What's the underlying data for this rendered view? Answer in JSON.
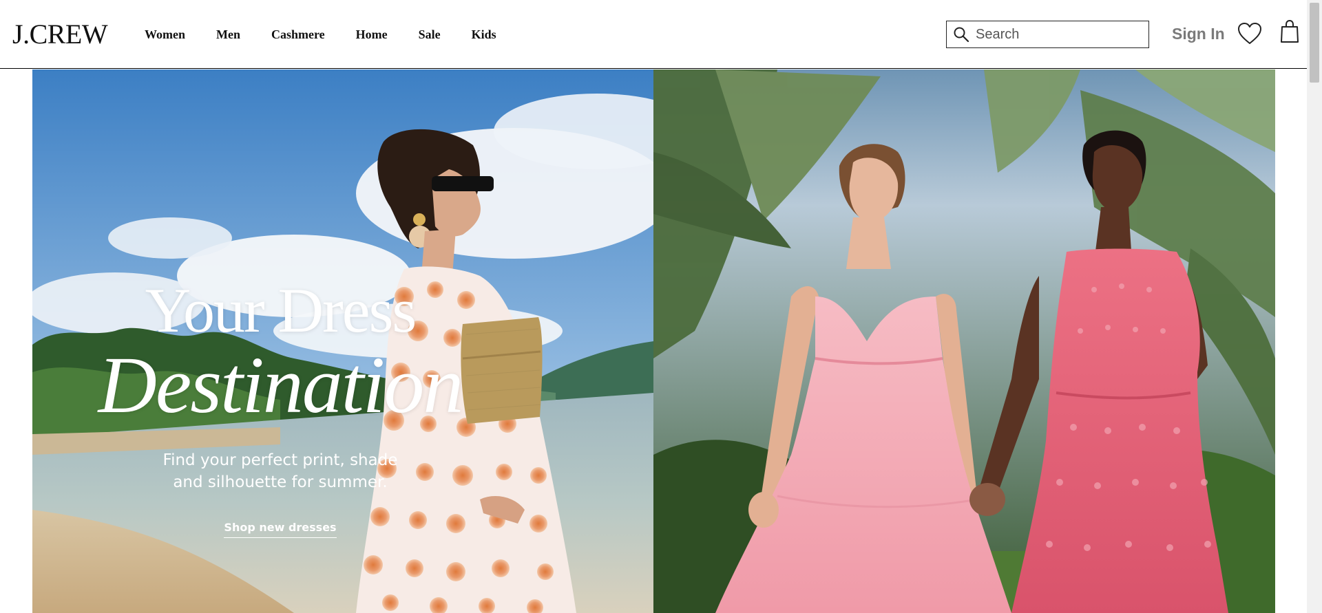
{
  "header": {
    "logo": "J.CREW",
    "nav": [
      "Women",
      "Men",
      "Cashmere",
      "Home",
      "Sale",
      "Kids"
    ],
    "search": {
      "placeholder": "Search",
      "value": ""
    },
    "signin_label": "Sign In",
    "icons": {
      "search": "search-icon",
      "wishlist": "heart-icon",
      "bag": "shopping-bag-icon"
    }
  },
  "hero": {
    "headline_line1": "Your Dress",
    "headline_line2": "Destination",
    "subline_1": "Find your perfect print, shade",
    "subline_2": "and silhouette for summer.",
    "cta": "Shop new dresses"
  },
  "colors": {
    "text": "#111111",
    "signin": "#7a7a7a",
    "pink_dress": "#f5b3bd",
    "coral_dress": "#e5667a"
  }
}
